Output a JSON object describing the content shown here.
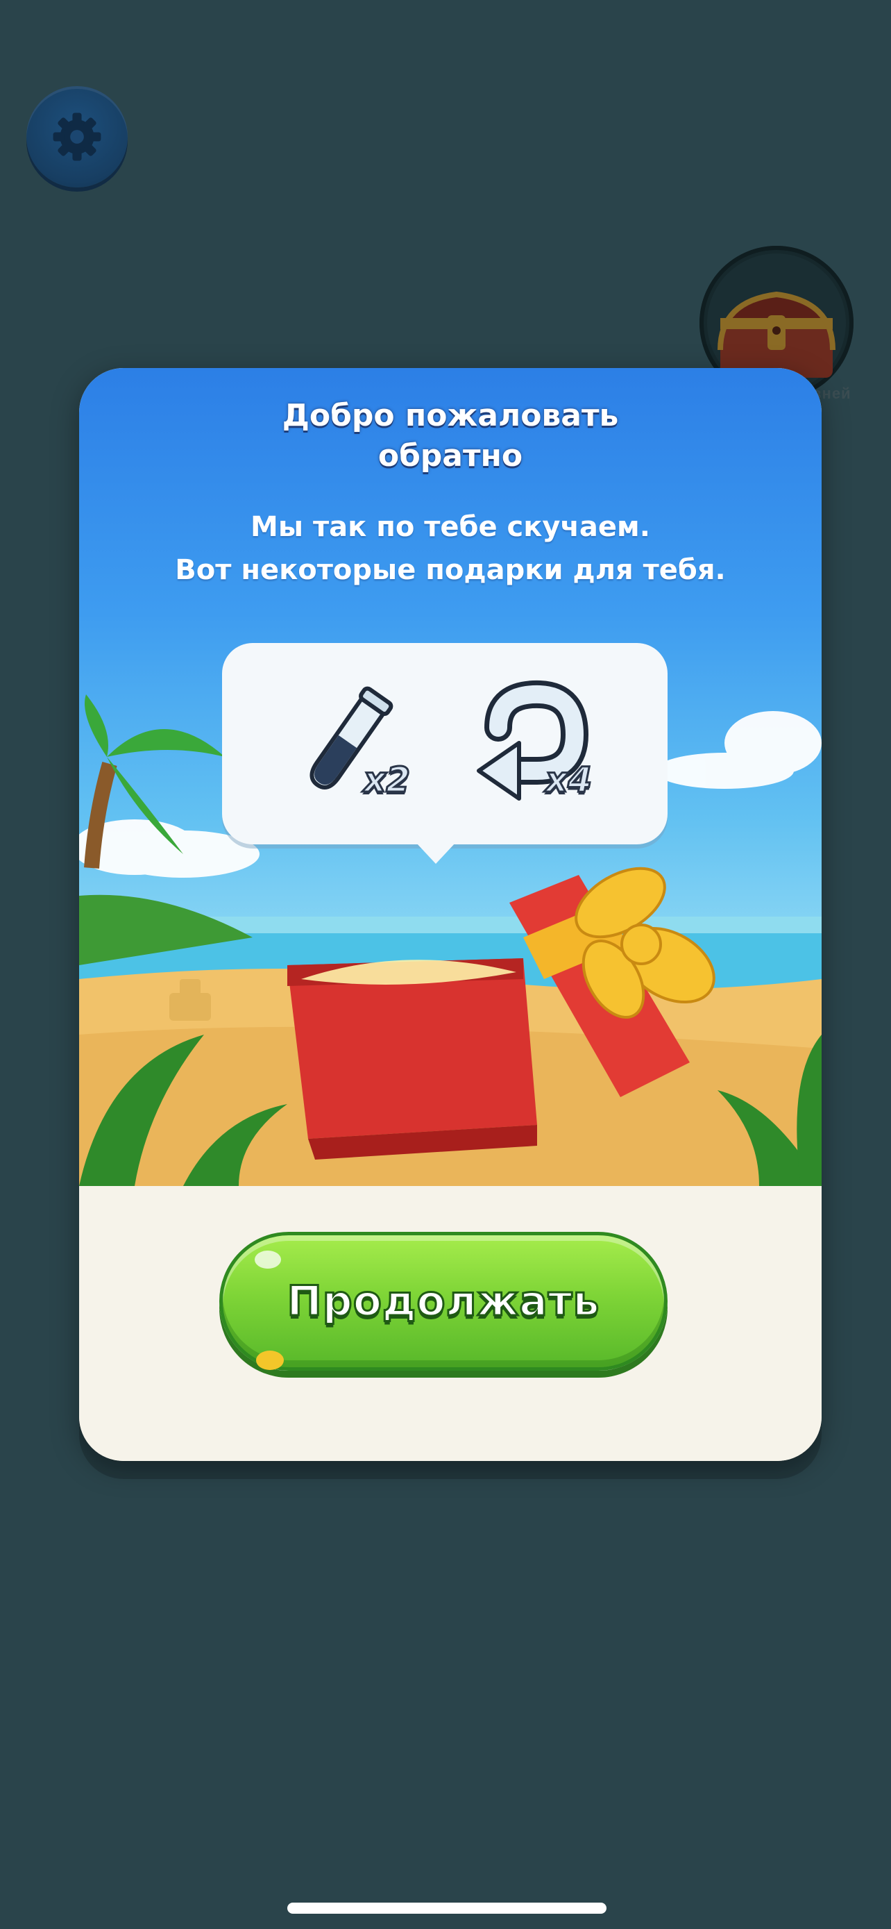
{
  "background": {
    "settings_icon": "gear-icon",
    "chest_icon": "treasure-chest-icon",
    "chest_label": "вней"
  },
  "modal": {
    "title": "Добро пожаловать\nобратно",
    "subtitle_line1": "Мы так по тебе скучаем.",
    "subtitle_line2": "Вот некоторые подарки для тебя.",
    "rewards": [
      {
        "icon": "test-tube-icon",
        "count": "x2"
      },
      {
        "icon": "undo-arrow-icon",
        "count": "x4"
      }
    ],
    "continue_label": "Продолжать"
  },
  "colors": {
    "backdrop": "#263f45",
    "button_green": "#7fd537",
    "sky_top": "#2c7fe6"
  }
}
